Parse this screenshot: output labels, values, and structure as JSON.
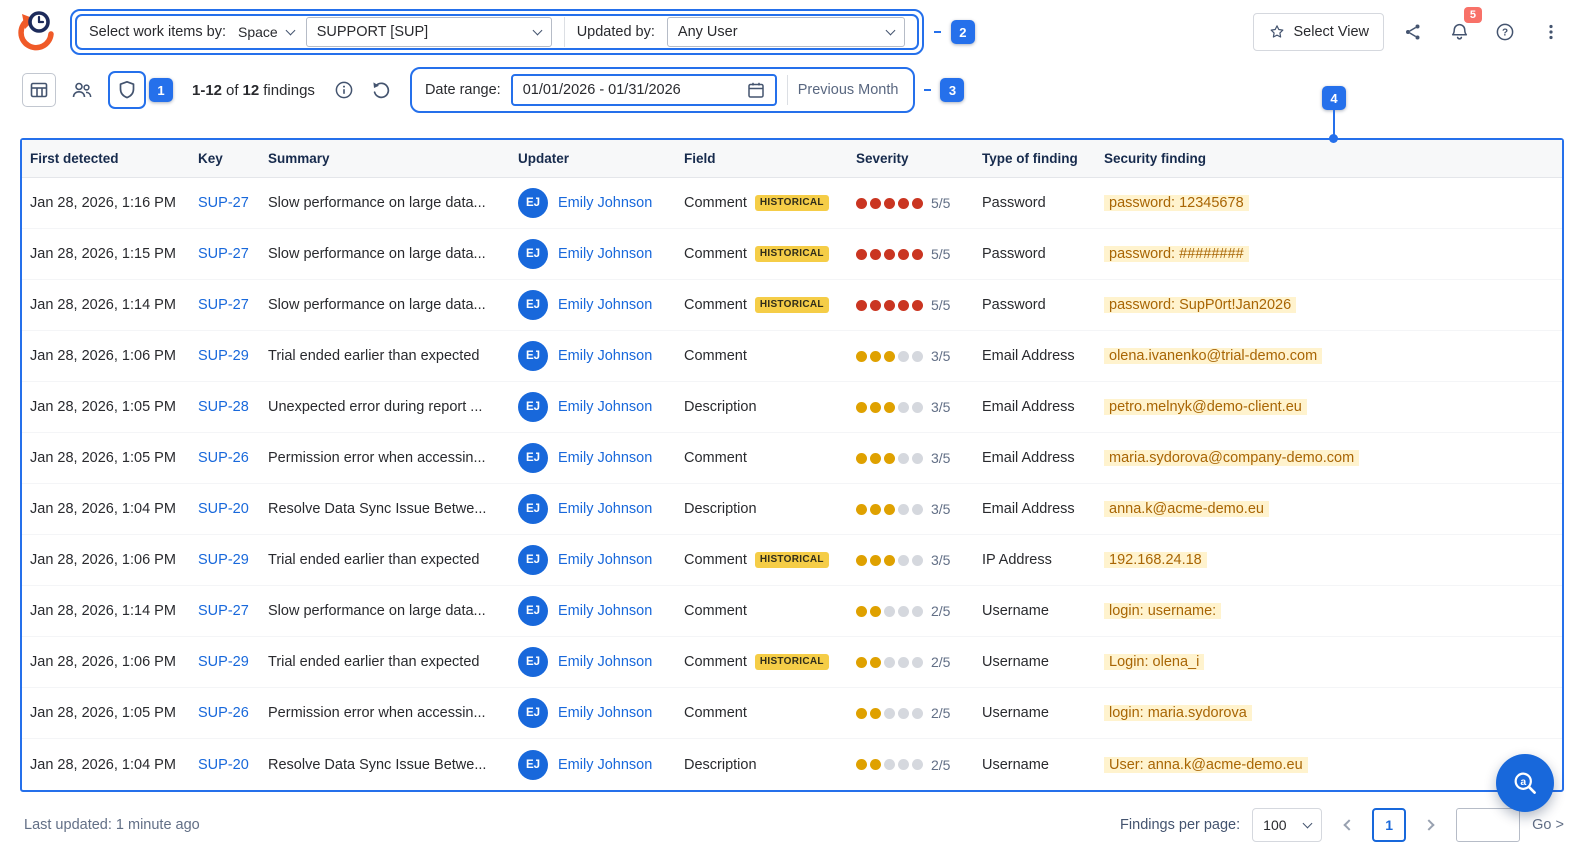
{
  "header": {
    "work_items_label": "Select work items by:",
    "space_value": "Space",
    "project_value": "SUPPORT [SUP]",
    "updated_by_label": "Updated by:",
    "user_value": "Any User",
    "select_view": "Select View",
    "notifications_count": "5"
  },
  "annotations": {
    "step1": "1",
    "step2": "2",
    "step3": "3",
    "step4": "4"
  },
  "toolbar": {
    "findings_range": "1-12",
    "of_label": "of",
    "findings_total": "12",
    "findings_word": "findings",
    "date_range_label": "Date range:",
    "date_range_value": "01/01/2026 - 01/31/2026",
    "quick_range": "Previous Month"
  },
  "table": {
    "columns": [
      "First detected",
      "Key",
      "Summary",
      "Updater",
      "Field",
      "Severity",
      "Type of finding",
      "Security finding"
    ],
    "rows": [
      {
        "first_detected": "Jan 28, 2026, 1:16 PM",
        "key": "SUP-27",
        "summary": "Slow performance on large data...",
        "updater_initials": "EJ",
        "updater": "Emily Johnson",
        "field": "Comment",
        "historical_label": "HISTORICAL",
        "severity": 5,
        "severity_color": "red",
        "severity_label": "5/5",
        "type": "Password",
        "finding": "password: 12345678"
      },
      {
        "first_detected": "Jan 28, 2026, 1:15 PM",
        "key": "SUP-27",
        "summary": "Slow performance on large data...",
        "updater_initials": "EJ",
        "updater": "Emily Johnson",
        "field": "Comment",
        "historical_label": "HISTORICAL",
        "severity": 5,
        "severity_color": "red",
        "severity_label": "5/5",
        "type": "Password",
        "finding": "password: ########"
      },
      {
        "first_detected": "Jan 28, 2026, 1:14 PM",
        "key": "SUP-27",
        "summary": "Slow performance on large data...",
        "updater_initials": "EJ",
        "updater": "Emily Johnson",
        "field": "Comment",
        "historical_label": "HISTORICAL",
        "severity": 5,
        "severity_color": "red",
        "severity_label": "5/5",
        "type": "Password",
        "finding": "password: SupP0rt!Jan2026"
      },
      {
        "first_detected": "Jan 28, 2026, 1:06 PM",
        "key": "SUP-29",
        "summary": "Trial ended earlier than expected",
        "updater_initials": "EJ",
        "updater": "Emily Johnson",
        "field": "Comment",
        "historical_label": "",
        "severity": 3,
        "severity_color": "yellow",
        "severity_label": "3/5",
        "type": "Email Address",
        "finding": "olena.ivanenko@trial-demo.com"
      },
      {
        "first_detected": "Jan 28, 2026, 1:05 PM",
        "key": "SUP-28",
        "summary": "Unexpected error during report ...",
        "updater_initials": "EJ",
        "updater": "Emily Johnson",
        "field": "Description",
        "historical_label": "",
        "severity": 3,
        "severity_color": "yellow",
        "severity_label": "3/5",
        "type": "Email Address",
        "finding": "petro.melnyk@demo-client.eu"
      },
      {
        "first_detected": "Jan 28, 2026, 1:05 PM",
        "key": "SUP-26",
        "summary": "Permission error when accessin...",
        "updater_initials": "EJ",
        "updater": "Emily Johnson",
        "field": "Comment",
        "historical_label": "",
        "severity": 3,
        "severity_color": "yellow",
        "severity_label": "3/5",
        "type": "Email Address",
        "finding": "maria.sydorova@company-demo.com"
      },
      {
        "first_detected": "Jan 28, 2026, 1:04 PM",
        "key": "SUP-20",
        "summary": "Resolve Data Sync Issue Betwe...",
        "updater_initials": "EJ",
        "updater": "Emily Johnson",
        "field": "Description",
        "historical_label": "",
        "severity": 3,
        "severity_color": "yellow",
        "severity_label": "3/5",
        "type": "Email Address",
        "finding": "anna.k@acme-demo.eu"
      },
      {
        "first_detected": "Jan 28, 2026, 1:06 PM",
        "key": "SUP-29",
        "summary": "Trial ended earlier than expected",
        "updater_initials": "EJ",
        "updater": "Emily Johnson",
        "field": "Comment",
        "historical_label": "HISTORICAL",
        "severity": 3,
        "severity_color": "yellow",
        "severity_label": "3/5",
        "type": "IP Address",
        "finding": "192.168.24.18"
      },
      {
        "first_detected": "Jan 28, 2026, 1:14 PM",
        "key": "SUP-27",
        "summary": "Slow performance on large data...",
        "updater_initials": "EJ",
        "updater": "Emily Johnson",
        "field": "Comment",
        "historical_label": "",
        "severity": 2,
        "severity_color": "yellow",
        "severity_label": "2/5",
        "type": "Username",
        "finding": "login: username:"
      },
      {
        "first_detected": "Jan 28, 2026, 1:06 PM",
        "key": "SUP-29",
        "summary": "Trial ended earlier than expected",
        "updater_initials": "EJ",
        "updater": "Emily Johnson",
        "field": "Comment",
        "historical_label": "HISTORICAL",
        "severity": 2,
        "severity_color": "yellow",
        "severity_label": "2/5",
        "type": "Username",
        "finding": "Login: olena_i"
      },
      {
        "first_detected": "Jan 28, 2026, 1:05 PM",
        "key": "SUP-26",
        "summary": "Permission error when accessin...",
        "updater_initials": "EJ",
        "updater": "Emily Johnson",
        "field": "Comment",
        "historical_label": "",
        "severity": 2,
        "severity_color": "yellow",
        "severity_label": "2/5",
        "type": "Username",
        "finding": "login: maria.sydorova"
      },
      {
        "first_detected": "Jan 28, 2026, 1:04 PM",
        "key": "SUP-20",
        "summary": "Resolve Data Sync Issue Betwe...",
        "updater_initials": "EJ",
        "updater": "Emily Johnson",
        "field": "Description",
        "historical_label": "",
        "severity": 2,
        "severity_color": "yellow",
        "severity_label": "2/5",
        "type": "Username",
        "finding": "User: anna.k@acme-demo.eu"
      }
    ]
  },
  "footer": {
    "last_updated": "Last updated: 1 minute ago",
    "per_page_label": "Findings per page:",
    "per_page_value": "100",
    "current_page": "1",
    "go_label": "Go >"
  },
  "colors": {
    "accent_blue": "#1868DB",
    "annotation_blue": "#2570EB",
    "severity_red": "#CA3521",
    "severity_yellow": "#DFA100",
    "severity_off": "#D5D8DE",
    "highlight_bg": "#FFF3CE",
    "highlight_text": "#A86504",
    "historical_bg": "#F5CD47",
    "notification_red": "#F87168"
  }
}
